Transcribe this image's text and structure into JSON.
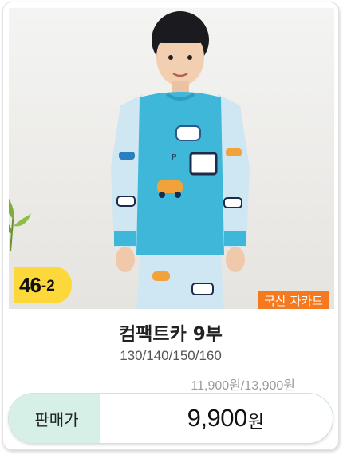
{
  "product": {
    "badge_number": "46",
    "badge_suffix": "-2",
    "tag": "국산 자카드",
    "name": "컴팩트카 9부",
    "sizes": "130/140/150/160",
    "original_price": "11,900원/13,900원",
    "sale_label": "판매가",
    "price": "9,900",
    "price_unit": "원"
  },
  "colors": {
    "badge": "#fdd83a",
    "tag": "#f5791f",
    "price_label_bg": "#d6f0e8",
    "shirt": "#3fb7d9"
  },
  "icons": [
    "product-photo"
  ]
}
